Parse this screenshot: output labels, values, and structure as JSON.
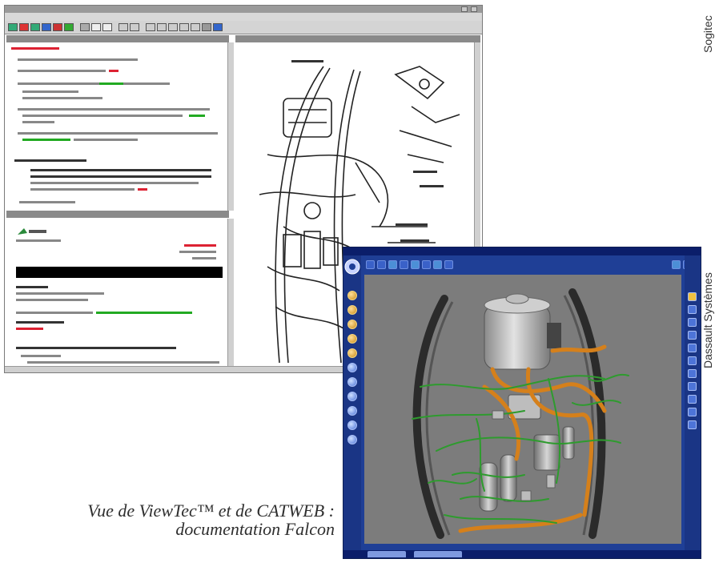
{
  "credits": {
    "sogitec": "Sogitec",
    "dassault": "Dassault Systèmes"
  },
  "caption": {
    "line1": "Vue de ViewTec™ et de CATWEB :",
    "line2": "documentation Falcon"
  },
  "colors": {
    "catweb_frame": "#1f3f96",
    "catweb_viewport": "#7c7c7c",
    "wire_green": "#2e9b2e",
    "wire_orange": "#d5801b"
  }
}
